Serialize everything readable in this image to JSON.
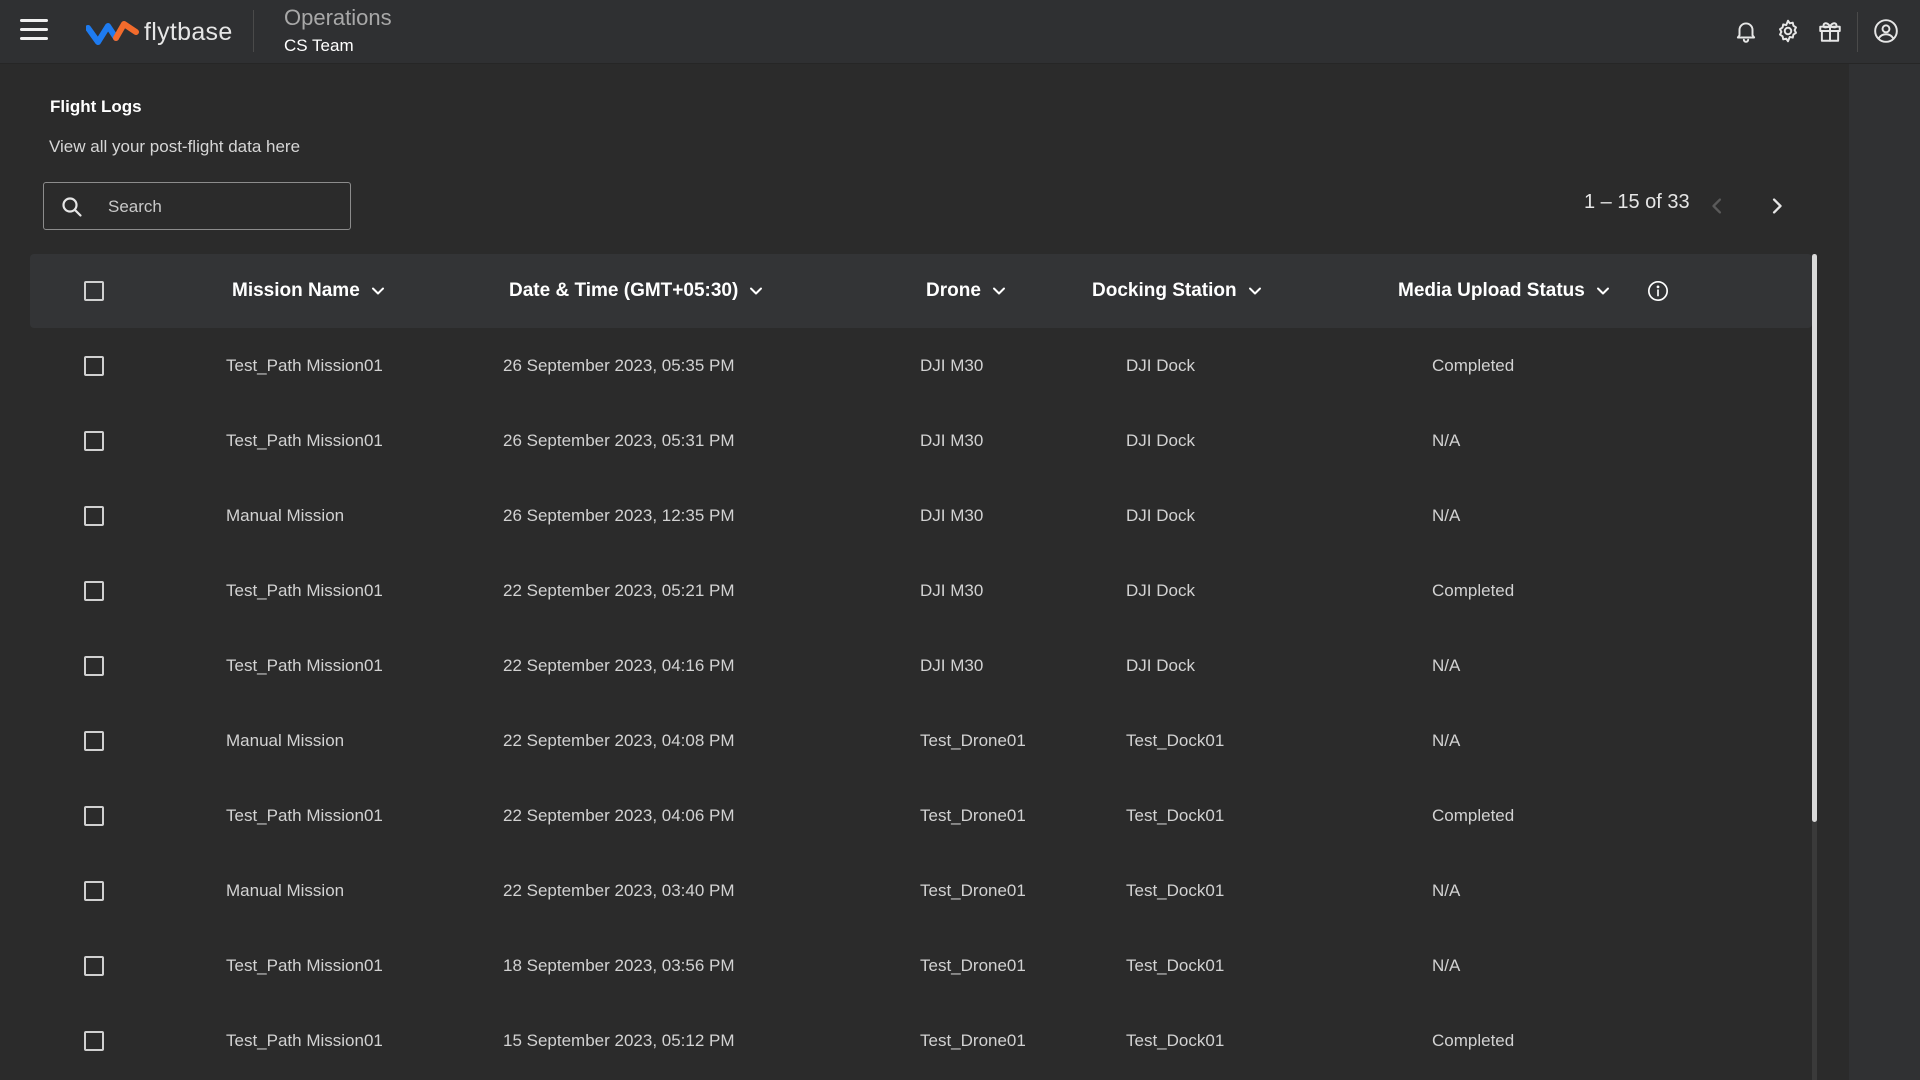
{
  "header": {
    "brand": "flytbase",
    "workspace_title": "Operations",
    "workspace_sub": "CS Team",
    "icons": [
      "menu-icon",
      "bell-icon",
      "gear-icon",
      "gift-icon",
      "account-icon"
    ]
  },
  "page": {
    "title": "Flight Logs",
    "subtitle": "View all your post-flight data here"
  },
  "search": {
    "placeholder": "Search",
    "value": ""
  },
  "pagination": {
    "text": "1 – 15 of 33"
  },
  "table": {
    "columns": [
      "Mission Name",
      "Date & Time (GMT+05:30)",
      "Drone",
      "Docking Station",
      "Media Upload Status"
    ],
    "rows": [
      {
        "mission": "Test_Path Mission01",
        "datetime": "26 September 2023, 05:35 PM",
        "drone": "DJI M30",
        "dock": "DJI Dock",
        "status": "Completed"
      },
      {
        "mission": "Test_Path Mission01",
        "datetime": "26 September 2023, 05:31 PM",
        "drone": "DJI M30",
        "dock": "DJI Dock",
        "status": "N/A"
      },
      {
        "mission": "Manual Mission",
        "datetime": "26 September 2023, 12:35 PM",
        "drone": "DJI M30",
        "dock": "DJI Dock",
        "status": "N/A"
      },
      {
        "mission": "Test_Path Mission01",
        "datetime": "22 September 2023, 05:21 PM",
        "drone": "DJI M30",
        "dock": "DJI Dock",
        "status": "Completed"
      },
      {
        "mission": "Test_Path Mission01",
        "datetime": "22 September 2023, 04:16 PM",
        "drone": "DJI M30",
        "dock": "DJI Dock",
        "status": "N/A"
      },
      {
        "mission": "Manual Mission",
        "datetime": "22 September 2023, 04:08 PM",
        "drone": "Test_Drone01",
        "dock": "Test_Dock01",
        "status": "N/A"
      },
      {
        "mission": "Test_Path Mission01",
        "datetime": "22 September 2023, 04:06 PM",
        "drone": "Test_Drone01",
        "dock": "Test_Dock01",
        "status": "Completed"
      },
      {
        "mission": "Manual Mission",
        "datetime": "22 September 2023, 03:40 PM",
        "drone": "Test_Drone01",
        "dock": "Test_Dock01",
        "status": "N/A"
      },
      {
        "mission": "Test_Path Mission01",
        "datetime": "18 September 2023, 03:56 PM",
        "drone": "Test_Drone01",
        "dock": "Test_Dock01",
        "status": "N/A"
      },
      {
        "mission": "Test_Path Mission01",
        "datetime": "15 September 2023, 05:12 PM",
        "drone": "Test_Drone01",
        "dock": "Test_Dock01",
        "status": "Completed"
      }
    ]
  },
  "colors": {
    "background": "#2b2b2b",
    "topbar": "#2f3032",
    "table_header": "#333436",
    "logo_blue": "#1e7bf0",
    "logo_orange": "#f26b2c"
  }
}
